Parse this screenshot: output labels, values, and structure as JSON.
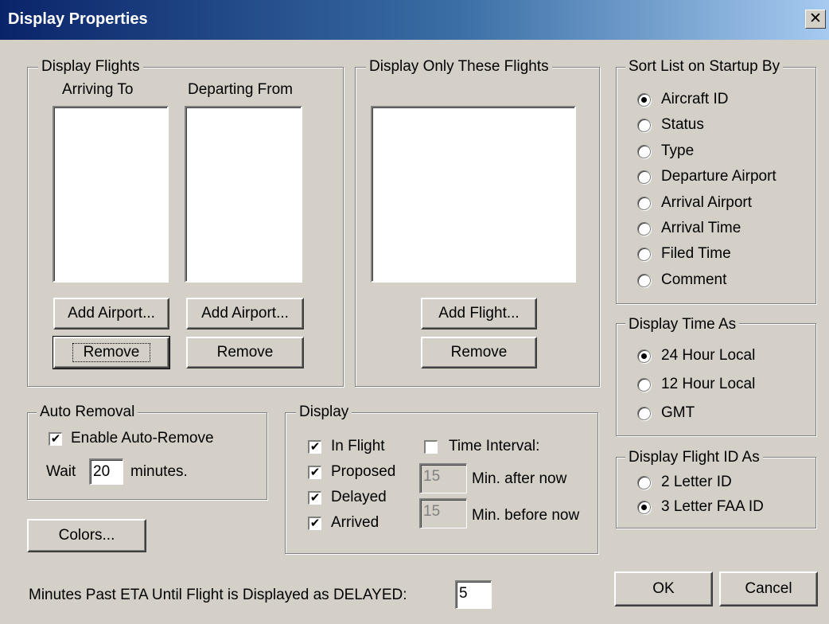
{
  "window": {
    "title": "Display Properties",
    "close_glyph": "✕"
  },
  "display_flights": {
    "legend": "Display Flights",
    "arriving_header": "Arriving To",
    "departing_header": "Departing From",
    "add_arriving_label": "Add Airport...",
    "add_departing_label": "Add Airport...",
    "remove_arriving_label": "Remove",
    "remove_departing_label": "Remove"
  },
  "display_only": {
    "legend": "Display Only These Flights",
    "add_flight_label": "Add Flight...",
    "remove_label": "Remove"
  },
  "sort_list": {
    "legend": "Sort List on Startup By",
    "options": [
      "Aircraft ID",
      "Status",
      "Type",
      "Departure Airport",
      "Arrival Airport",
      "Arrival Time",
      "Filed Time",
      "Comment"
    ],
    "selected": "Aircraft ID"
  },
  "display_time": {
    "legend": "Display Time As",
    "options": [
      "24 Hour Local",
      "12 Hour Local",
      "GMT"
    ],
    "selected": "24 Hour Local"
  },
  "display_flight_id": {
    "legend": "Display Flight ID As",
    "options": [
      "2 Letter ID",
      "3 Letter FAA ID"
    ],
    "selected": "3 Letter FAA ID"
  },
  "auto_removal": {
    "legend": "Auto Removal",
    "enable_label": "Enable Auto-Remove",
    "enable_checked": true,
    "wait_label": "Wait",
    "wait_value": "20",
    "minutes_label": "minutes."
  },
  "display": {
    "legend": "Display",
    "in_flight_label": "In Flight",
    "proposed_label": "Proposed",
    "delayed_label": "Delayed",
    "arrived_label": "Arrived",
    "time_interval_label": "Time Interval:",
    "after_value": "15",
    "after_label": "Min. after now",
    "before_value": "15",
    "before_label": "Min. before now"
  },
  "colors_label": "Colors...",
  "delayed_threshold": {
    "label": "Minutes Past ETA Until Flight is Displayed as DELAYED:",
    "value": "5"
  },
  "ok_label": "OK",
  "cancel_label": "Cancel",
  "check_glyph": "✔"
}
